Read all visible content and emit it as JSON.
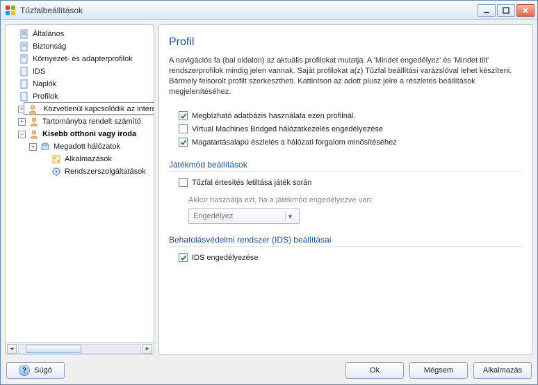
{
  "window": {
    "title": "Tűzfalbeállítások"
  },
  "tree": {
    "n0": "Általános",
    "n1": "Biztonság",
    "n2": "Környezet- és adapterprofilok",
    "n3": "IDS",
    "n4": "Naplók",
    "n5": "Profilok",
    "n5a_tooltip": "Közvetlenül kapcsolódik az internetre",
    "n5a_short": "Közvetlenül kapcsolódik az",
    "n5b": "Tartományba rendelt számító",
    "n5c": "Kisebb otthoni vagy iroda",
    "n5c1": "Megadott hálózatok",
    "n5c2": "Alkalmazások",
    "n5c3": "Rendszerszolgáltatások"
  },
  "main": {
    "title": "Profil",
    "description": "A navigációs fa (bal oldalon) az aktuális profilokat mutatja. A 'Mindet engedélyez' és 'Mindet tilt' rendszerprofilok mindig jelen vannak. Saját profilokat a(z) Tűzfal beállítási varázslóval lehet készíteni. Bármely felsorolt profilt szerkesztheti. Kattintson az adott plusz jelre a részletes beállítások megjelenítéséhez.",
    "check1": {
      "label": "Megbízható adatbázis  használata ezen profilnál.",
      "checked": true
    },
    "check2": {
      "label": "Virtual Machines Bridged hálózatkezelés engedélyezése",
      "checked": false
    },
    "check3": {
      "label": "Magatartásalapú észlelés a hálózati forgalom minősítéséhez",
      "checked": true
    },
    "game_section": "Játékmód beállítások",
    "check4": {
      "label": "Tűzfal értesítés letiltása játék során",
      "checked": false
    },
    "game_hint": "Akkor használja ezt, ha a játékmód engedélyezve van:",
    "combo_value": "Engedélyez",
    "ids_section": "Behatolásvédelmi rendszer (IDS) beállításai",
    "check5": {
      "label": "IDS engedélyezése",
      "checked": true
    }
  },
  "footer": {
    "help": "Súgó",
    "ok": "Ok",
    "cancel": "Mégsem",
    "apply": "Alkalmazás"
  }
}
